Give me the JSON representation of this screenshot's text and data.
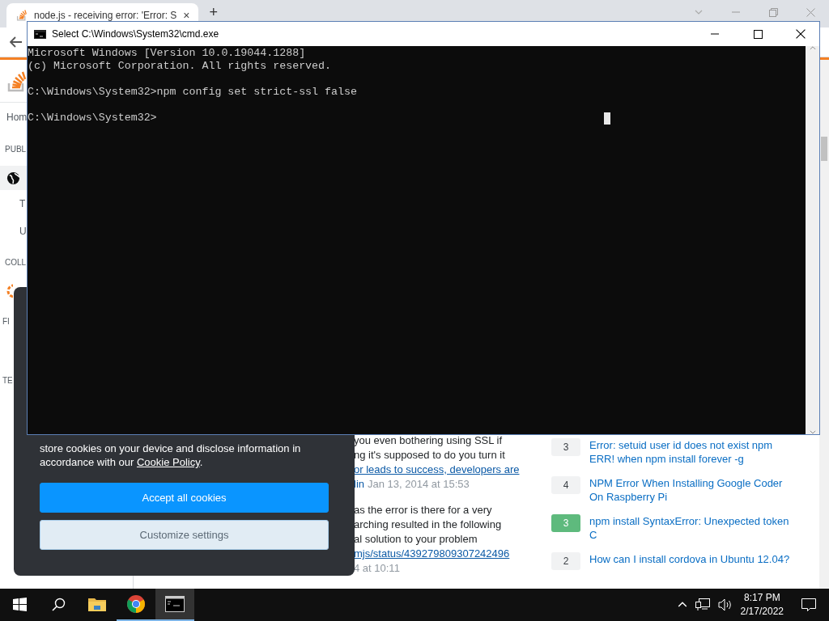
{
  "browser": {
    "tab": {
      "title": "node.js - receiving error: 'Error: S",
      "close": "×"
    },
    "new_tab": "+",
    "sidebar": [
      {
        "kind": "text",
        "label": "Hom",
        "selected": false
      },
      {
        "kind": "heading",
        "label": "PUBL",
        "selected": false
      },
      {
        "kind": "globe",
        "selected": true
      },
      {
        "kind": "sub",
        "label": "T",
        "selected": false
      },
      {
        "kind": "sub",
        "label": "U",
        "selected": false
      },
      {
        "kind": "heading",
        "label": "COLL",
        "selected": false
      },
      {
        "kind": "collective",
        "selected": false
      },
      {
        "kind": "heading",
        "label": "FI",
        "selected": false
      },
      {
        "kind": "heading",
        "label": "TE",
        "selected": false
      }
    ],
    "comments": [
      {
        "lines": [
          "you even bothering using SSL if",
          "ng it's supposed to do you turn it"
        ],
        "link": "or leads to success, developers are",
        "author": "lin",
        "date": "Jan 13, 2014 at 15:53"
      },
      {
        "lines": [
          "as the error is there for a very",
          "arching resulted in the following",
          "al solution to your problem"
        ],
        "link": "mjs/status/439279809307242496",
        "date": "4 at 10:11"
      }
    ],
    "related": [
      {
        "score": "3",
        "accepted": false,
        "title": "Error: setuid user id does not exist npm ERR! when npm install forever -g"
      },
      {
        "score": "4",
        "accepted": false,
        "title": "NPM Error When Installing Google Coder On Raspberry Pi"
      },
      {
        "score": "3",
        "accepted": true,
        "title": "npm install SyntaxError: Unexpected token C"
      },
      {
        "score": "2",
        "accepted": false,
        "title": "How can I install cordova in Ubuntu 12.04?"
      }
    ]
  },
  "cookie_dialog": {
    "text": "store cookies on your device and disclose information in accordance with our ",
    "link": "Cookie Policy",
    "text_end": ".",
    "buttons": [
      {
        "kind": "primary",
        "label": "Accept all cookies"
      },
      {
        "kind": "secondary",
        "label": "Customize settings"
      }
    ]
  },
  "cmd": {
    "title": "Select C:\\Windows\\System32\\cmd.exe",
    "blocks": [
      [
        "Microsoft Windows [Version 10.0.19044.1288]",
        "(c) Microsoft Corporation. All rights reserved."
      ],
      [
        "C:\\Windows\\System32>npm config set strict-ssl false"
      ],
      [
        "C:\\Windows\\System32>"
      ]
    ]
  },
  "taskbar": {
    "apps": [
      {
        "kind": "folder",
        "running": false,
        "selected": false
      },
      {
        "kind": "chrome",
        "running": true,
        "selected": false
      },
      {
        "kind": "terminal",
        "running": true,
        "selected": true
      }
    ],
    "time": "8:17 PM",
    "date": "2/17/2022"
  }
}
